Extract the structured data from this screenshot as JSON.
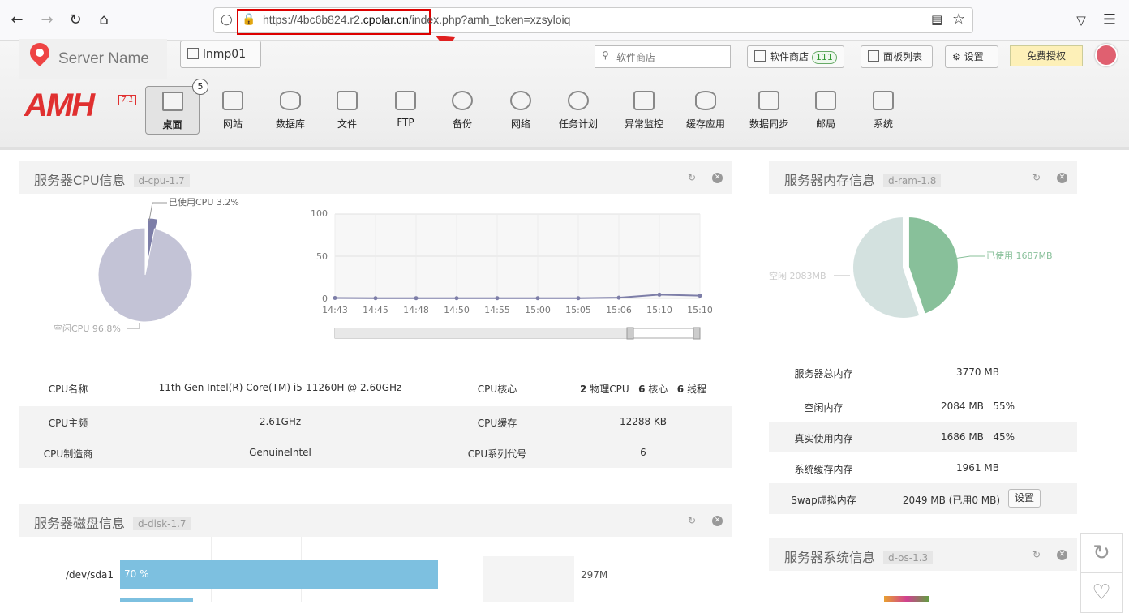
{
  "browser": {
    "url_prefix": "https://4bc6b824.r2.",
    "url_domain": "cpolar.cn",
    "url_suffix": "/index.php?amh_token=xzsyloiq"
  },
  "topbar": {
    "server_name": "Server Name",
    "site_button": "lnmp01",
    "search_placeholder": "软件商店",
    "store_label": "软件商店",
    "store_count": "111",
    "panel_list": "面板列表",
    "settings": "设置",
    "license": "免费授权"
  },
  "logo": {
    "text": "AMH",
    "version": "7.1"
  },
  "menu": {
    "badge": "5",
    "items": [
      "桌面",
      "网站",
      "数据库",
      "文件",
      "FTP",
      "备份",
      "网络",
      "任务计划",
      "异常监控",
      "缓存应用",
      "数据同步",
      "邮局",
      "系统"
    ]
  },
  "cpu_panel": {
    "title": "服务器CPU信息",
    "tag": "d-cpu-1.7",
    "used_label": "已使用CPU 3.2%",
    "free_label": "空闲CPU 96.8%",
    "rows": [
      {
        "k1": "CPU名称",
        "v1": "11th Gen Intel(R) Core(TM) i5-11260H @ 2.60GHz",
        "k2": "CPU核心",
        "v2": ""
      },
      {
        "k1": "CPU主频",
        "v1": "2.61GHz",
        "k2": "CPU缓存",
        "v2": "12288 KB"
      },
      {
        "k1": "CPU制造商",
        "v1": "GenuineIntel",
        "k2": "CPU系列代号",
        "v2": "6"
      }
    ],
    "cores": {
      "n1": "2",
      "l1": "物理CPU",
      "n2": "6",
      "l2": "核心",
      "n3": "6",
      "l3": "线程"
    }
  },
  "chart_data": [
    {
      "type": "pie",
      "labels": [
        "已使用CPU",
        "空闲CPU"
      ],
      "values": [
        3.2,
        96.8
      ]
    },
    {
      "type": "line",
      "x": [
        "14:43",
        "14:45",
        "14:48",
        "14:50",
        "14:55",
        "15:00",
        "15:05",
        "15:06",
        "15:10",
        "15:10"
      ],
      "series": [
        {
          "values": [
            0.5,
            0.2,
            0.3,
            0.2,
            0.3,
            0.2,
            0.2,
            0.8,
            4.5,
            3.2
          ]
        }
      ],
      "yticks": [
        "100",
        "50",
        "0"
      ],
      "ylim": [
        0,
        100
      ],
      "grid": true
    },
    {
      "type": "pie",
      "labels": [
        "已使用",
        "空闲"
      ],
      "values": [
        1687,
        2083
      ]
    }
  ],
  "ram_panel": {
    "title": "服务器内存信息",
    "tag": "d-ram-1.8",
    "used_label": "已使用 1687MB",
    "free_label": "空闲 2083MB",
    "rows": [
      {
        "k": "服务器总内存",
        "v": "3770 MB"
      },
      {
        "k": "空闲内存",
        "v": "2084 MB   55%"
      },
      {
        "k": "真实使用内存",
        "v": "1686 MB   45%"
      },
      {
        "k": "系统缓存内存",
        "v": "1961 MB"
      },
      {
        "k": "Swap虚拟内存",
        "v": "2049 MB (已用0 MB)"
      }
    ],
    "swap_button": "设置"
  },
  "disk_panel": {
    "title": "服务器磁盘信息",
    "tag": "d-disk-1.7",
    "disk_name": "/dev/sda1",
    "disk_percent": "70 %",
    "disk_size": "297M",
    "disk_fill": 0.7
  },
  "os_panel": {
    "title": "服务器系统信息",
    "tag": "d-os-1.3"
  },
  "colors": {
    "accent_red": "#e03030",
    "ram_used": "#88c09a",
    "ram_free": "#d3e1df",
    "cpu_pie": "#c3c3d6",
    "line": "#7d7ea8"
  }
}
